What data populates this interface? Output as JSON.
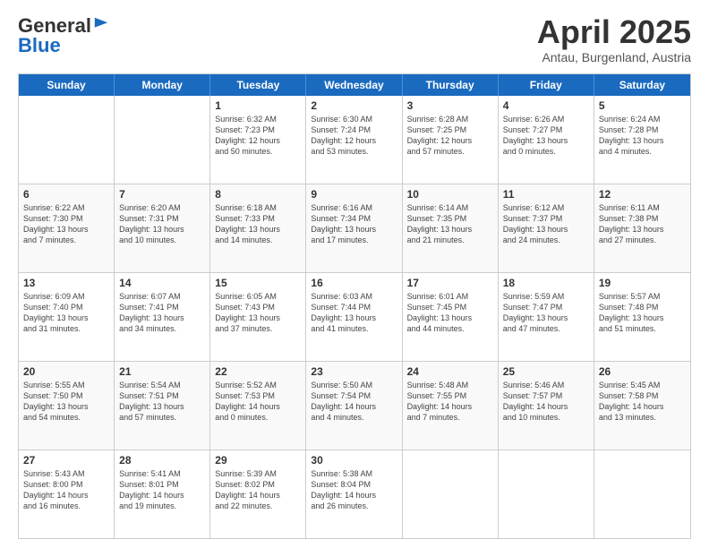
{
  "header": {
    "logo_general": "General",
    "logo_blue": "Blue",
    "month_title": "April 2025",
    "subtitle": "Antau, Burgenland, Austria"
  },
  "weekdays": [
    "Sunday",
    "Monday",
    "Tuesday",
    "Wednesday",
    "Thursday",
    "Friday",
    "Saturday"
  ],
  "rows": [
    [
      {
        "day": "",
        "info": ""
      },
      {
        "day": "",
        "info": ""
      },
      {
        "day": "1",
        "info": "Sunrise: 6:32 AM\nSunset: 7:23 PM\nDaylight: 12 hours\nand 50 minutes."
      },
      {
        "day": "2",
        "info": "Sunrise: 6:30 AM\nSunset: 7:24 PM\nDaylight: 12 hours\nand 53 minutes."
      },
      {
        "day": "3",
        "info": "Sunrise: 6:28 AM\nSunset: 7:25 PM\nDaylight: 12 hours\nand 57 minutes."
      },
      {
        "day": "4",
        "info": "Sunrise: 6:26 AM\nSunset: 7:27 PM\nDaylight: 13 hours\nand 0 minutes."
      },
      {
        "day": "5",
        "info": "Sunrise: 6:24 AM\nSunset: 7:28 PM\nDaylight: 13 hours\nand 4 minutes."
      }
    ],
    [
      {
        "day": "6",
        "info": "Sunrise: 6:22 AM\nSunset: 7:30 PM\nDaylight: 13 hours\nand 7 minutes."
      },
      {
        "day": "7",
        "info": "Sunrise: 6:20 AM\nSunset: 7:31 PM\nDaylight: 13 hours\nand 10 minutes."
      },
      {
        "day": "8",
        "info": "Sunrise: 6:18 AM\nSunset: 7:33 PM\nDaylight: 13 hours\nand 14 minutes."
      },
      {
        "day": "9",
        "info": "Sunrise: 6:16 AM\nSunset: 7:34 PM\nDaylight: 13 hours\nand 17 minutes."
      },
      {
        "day": "10",
        "info": "Sunrise: 6:14 AM\nSunset: 7:35 PM\nDaylight: 13 hours\nand 21 minutes."
      },
      {
        "day": "11",
        "info": "Sunrise: 6:12 AM\nSunset: 7:37 PM\nDaylight: 13 hours\nand 24 minutes."
      },
      {
        "day": "12",
        "info": "Sunrise: 6:11 AM\nSunset: 7:38 PM\nDaylight: 13 hours\nand 27 minutes."
      }
    ],
    [
      {
        "day": "13",
        "info": "Sunrise: 6:09 AM\nSunset: 7:40 PM\nDaylight: 13 hours\nand 31 minutes."
      },
      {
        "day": "14",
        "info": "Sunrise: 6:07 AM\nSunset: 7:41 PM\nDaylight: 13 hours\nand 34 minutes."
      },
      {
        "day": "15",
        "info": "Sunrise: 6:05 AM\nSunset: 7:43 PM\nDaylight: 13 hours\nand 37 minutes."
      },
      {
        "day": "16",
        "info": "Sunrise: 6:03 AM\nSunset: 7:44 PM\nDaylight: 13 hours\nand 41 minutes."
      },
      {
        "day": "17",
        "info": "Sunrise: 6:01 AM\nSunset: 7:45 PM\nDaylight: 13 hours\nand 44 minutes."
      },
      {
        "day": "18",
        "info": "Sunrise: 5:59 AM\nSunset: 7:47 PM\nDaylight: 13 hours\nand 47 minutes."
      },
      {
        "day": "19",
        "info": "Sunrise: 5:57 AM\nSunset: 7:48 PM\nDaylight: 13 hours\nand 51 minutes."
      }
    ],
    [
      {
        "day": "20",
        "info": "Sunrise: 5:55 AM\nSunset: 7:50 PM\nDaylight: 13 hours\nand 54 minutes."
      },
      {
        "day": "21",
        "info": "Sunrise: 5:54 AM\nSunset: 7:51 PM\nDaylight: 13 hours\nand 57 minutes."
      },
      {
        "day": "22",
        "info": "Sunrise: 5:52 AM\nSunset: 7:53 PM\nDaylight: 14 hours\nand 0 minutes."
      },
      {
        "day": "23",
        "info": "Sunrise: 5:50 AM\nSunset: 7:54 PM\nDaylight: 14 hours\nand 4 minutes."
      },
      {
        "day": "24",
        "info": "Sunrise: 5:48 AM\nSunset: 7:55 PM\nDaylight: 14 hours\nand 7 minutes."
      },
      {
        "day": "25",
        "info": "Sunrise: 5:46 AM\nSunset: 7:57 PM\nDaylight: 14 hours\nand 10 minutes."
      },
      {
        "day": "26",
        "info": "Sunrise: 5:45 AM\nSunset: 7:58 PM\nDaylight: 14 hours\nand 13 minutes."
      }
    ],
    [
      {
        "day": "27",
        "info": "Sunrise: 5:43 AM\nSunset: 8:00 PM\nDaylight: 14 hours\nand 16 minutes."
      },
      {
        "day": "28",
        "info": "Sunrise: 5:41 AM\nSunset: 8:01 PM\nDaylight: 14 hours\nand 19 minutes."
      },
      {
        "day": "29",
        "info": "Sunrise: 5:39 AM\nSunset: 8:02 PM\nDaylight: 14 hours\nand 22 minutes."
      },
      {
        "day": "30",
        "info": "Sunrise: 5:38 AM\nSunset: 8:04 PM\nDaylight: 14 hours\nand 26 minutes."
      },
      {
        "day": "",
        "info": ""
      },
      {
        "day": "",
        "info": ""
      },
      {
        "day": "",
        "info": ""
      }
    ]
  ]
}
